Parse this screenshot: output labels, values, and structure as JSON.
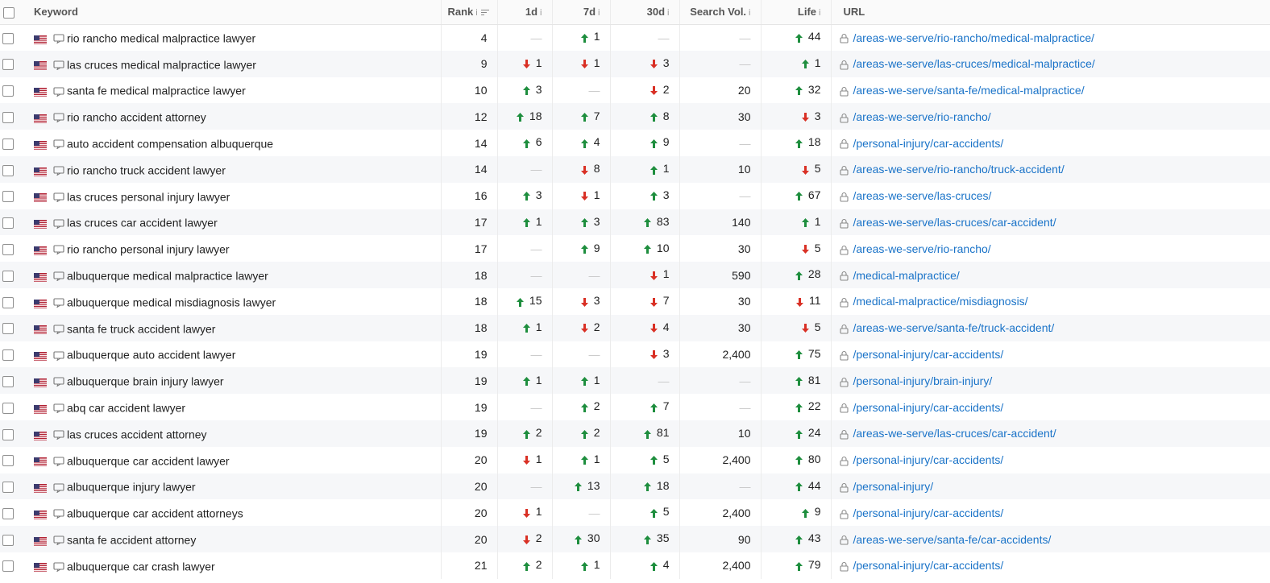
{
  "columns": {
    "keyword": "Keyword",
    "rank": "Rank",
    "d1": "1d",
    "d7": "7d",
    "d30": "30d",
    "search_vol": "Search Vol.",
    "life": "Life",
    "url": "URL"
  },
  "info_glyph": "i",
  "dash": "—",
  "colors": {
    "up": "#1e8e3e",
    "down": "#d93025",
    "link": "#1a73c8"
  },
  "icons": {
    "flag": "us-flag-icon",
    "serp": "serp-preview-icon",
    "lock": "lock-icon",
    "up": "arrow-up-icon",
    "down": "arrow-down-icon",
    "sort": "sort-icon"
  },
  "rows": [
    {
      "keyword": "rio rancho medical malpractice lawyer",
      "rank": "4",
      "d1": null,
      "d7": {
        "dir": "up",
        "value": "1"
      },
      "d30": null,
      "search_vol": null,
      "life": {
        "dir": "up",
        "value": "44"
      },
      "url": "/areas-we-serve/rio-rancho/medical-malpractice/"
    },
    {
      "keyword": "las cruces medical malpractice lawyer",
      "rank": "9",
      "d1": {
        "dir": "down",
        "value": "1"
      },
      "d7": {
        "dir": "down",
        "value": "1"
      },
      "d30": {
        "dir": "down",
        "value": "3"
      },
      "search_vol": null,
      "life": {
        "dir": "up",
        "value": "1"
      },
      "url": "/areas-we-serve/las-cruces/medical-malpractice/"
    },
    {
      "keyword": "santa fe medical malpractice lawyer",
      "rank": "10",
      "d1": {
        "dir": "up",
        "value": "3"
      },
      "d7": null,
      "d30": {
        "dir": "down",
        "value": "2"
      },
      "search_vol": "20",
      "life": {
        "dir": "up",
        "value": "32"
      },
      "url": "/areas-we-serve/santa-fe/medical-malpractice/"
    },
    {
      "keyword": "rio rancho accident attorney",
      "rank": "12",
      "d1": {
        "dir": "up",
        "value": "18"
      },
      "d7": {
        "dir": "up",
        "value": "7"
      },
      "d30": {
        "dir": "up",
        "value": "8"
      },
      "search_vol": "30",
      "life": {
        "dir": "down",
        "value": "3"
      },
      "url": "/areas-we-serve/rio-rancho/"
    },
    {
      "keyword": "auto accident compensation albuquerque",
      "rank": "14",
      "d1": {
        "dir": "up",
        "value": "6"
      },
      "d7": {
        "dir": "up",
        "value": "4"
      },
      "d30": {
        "dir": "up",
        "value": "9"
      },
      "search_vol": null,
      "life": {
        "dir": "up",
        "value": "18"
      },
      "url": "/personal-injury/car-accidents/"
    },
    {
      "keyword": "rio rancho truck accident lawyer",
      "rank": "14",
      "d1": null,
      "d7": {
        "dir": "down",
        "value": "8"
      },
      "d30": {
        "dir": "up",
        "value": "1"
      },
      "search_vol": "10",
      "life": {
        "dir": "down",
        "value": "5"
      },
      "url": "/areas-we-serve/rio-rancho/truck-accident/"
    },
    {
      "keyword": "las cruces personal injury lawyer",
      "rank": "16",
      "d1": {
        "dir": "up",
        "value": "3"
      },
      "d7": {
        "dir": "down",
        "value": "1"
      },
      "d30": {
        "dir": "up",
        "value": "3"
      },
      "search_vol": null,
      "life": {
        "dir": "up",
        "value": "67"
      },
      "url": "/areas-we-serve/las-cruces/"
    },
    {
      "keyword": "las cruces car accident lawyer",
      "rank": "17",
      "d1": {
        "dir": "up",
        "value": "1"
      },
      "d7": {
        "dir": "up",
        "value": "3"
      },
      "d30": {
        "dir": "up",
        "value": "83"
      },
      "search_vol": "140",
      "life": {
        "dir": "up",
        "value": "1"
      },
      "url": "/areas-we-serve/las-cruces/car-accident/"
    },
    {
      "keyword": "rio rancho personal injury lawyer",
      "rank": "17",
      "d1": null,
      "d7": {
        "dir": "up",
        "value": "9"
      },
      "d30": {
        "dir": "up",
        "value": "10"
      },
      "search_vol": "30",
      "life": {
        "dir": "down",
        "value": "5"
      },
      "url": "/areas-we-serve/rio-rancho/"
    },
    {
      "keyword": "albuquerque medical malpractice lawyer",
      "rank": "18",
      "d1": null,
      "d7": null,
      "d30": {
        "dir": "down",
        "value": "1"
      },
      "search_vol": "590",
      "life": {
        "dir": "up",
        "value": "28"
      },
      "url": "/medical-malpractice/"
    },
    {
      "keyword": "albuquerque medical misdiagnosis lawyer",
      "rank": "18",
      "d1": {
        "dir": "up",
        "value": "15"
      },
      "d7": {
        "dir": "down",
        "value": "3"
      },
      "d30": {
        "dir": "down",
        "value": "7"
      },
      "search_vol": "30",
      "life": {
        "dir": "down",
        "value": "11"
      },
      "url": "/medical-malpractice/misdiagnosis/"
    },
    {
      "keyword": "santa fe truck accident lawyer",
      "rank": "18",
      "d1": {
        "dir": "up",
        "value": "1"
      },
      "d7": {
        "dir": "down",
        "value": "2"
      },
      "d30": {
        "dir": "down",
        "value": "4"
      },
      "search_vol": "30",
      "life": {
        "dir": "down",
        "value": "5"
      },
      "url": "/areas-we-serve/santa-fe/truck-accident/"
    },
    {
      "keyword": "albuquerque auto accident lawyer",
      "rank": "19",
      "d1": null,
      "d7": null,
      "d30": {
        "dir": "down",
        "value": "3"
      },
      "search_vol": "2,400",
      "life": {
        "dir": "up",
        "value": "75"
      },
      "url": "/personal-injury/car-accidents/"
    },
    {
      "keyword": "albuquerque brain injury lawyer",
      "rank": "19",
      "d1": {
        "dir": "up",
        "value": "1"
      },
      "d7": {
        "dir": "up",
        "value": "1"
      },
      "d30": null,
      "search_vol": null,
      "life": {
        "dir": "up",
        "value": "81"
      },
      "url": "/personal-injury/brain-injury/"
    },
    {
      "keyword": "abq car accident lawyer",
      "rank": "19",
      "d1": null,
      "d7": {
        "dir": "up",
        "value": "2"
      },
      "d30": {
        "dir": "up",
        "value": "7"
      },
      "search_vol": null,
      "life": {
        "dir": "up",
        "value": "22"
      },
      "url": "/personal-injury/car-accidents/"
    },
    {
      "keyword": "las cruces accident attorney",
      "rank": "19",
      "d1": {
        "dir": "up",
        "value": "2"
      },
      "d7": {
        "dir": "up",
        "value": "2"
      },
      "d30": {
        "dir": "up",
        "value": "81"
      },
      "search_vol": "10",
      "life": {
        "dir": "up",
        "value": "24"
      },
      "url": "/areas-we-serve/las-cruces/car-accident/"
    },
    {
      "keyword": "albuquerque car accident lawyer",
      "rank": "20",
      "d1": {
        "dir": "down",
        "value": "1"
      },
      "d7": {
        "dir": "up",
        "value": "1"
      },
      "d30": {
        "dir": "up",
        "value": "5"
      },
      "search_vol": "2,400",
      "life": {
        "dir": "up",
        "value": "80"
      },
      "url": "/personal-injury/car-accidents/"
    },
    {
      "keyword": "albuquerque injury lawyer",
      "rank": "20",
      "d1": null,
      "d7": {
        "dir": "up",
        "value": "13"
      },
      "d30": {
        "dir": "up",
        "value": "18"
      },
      "search_vol": null,
      "life": {
        "dir": "up",
        "value": "44"
      },
      "url": "/personal-injury/"
    },
    {
      "keyword": "albuquerque car accident attorneys",
      "rank": "20",
      "d1": {
        "dir": "down",
        "value": "1"
      },
      "d7": null,
      "d30": {
        "dir": "up",
        "value": "5"
      },
      "search_vol": "2,400",
      "life": {
        "dir": "up",
        "value": "9"
      },
      "url": "/personal-injury/car-accidents/"
    },
    {
      "keyword": "santa fe accident attorney",
      "rank": "20",
      "d1": {
        "dir": "down",
        "value": "2"
      },
      "d7": {
        "dir": "up",
        "value": "30"
      },
      "d30": {
        "dir": "up",
        "value": "35"
      },
      "search_vol": "90",
      "life": {
        "dir": "up",
        "value": "43"
      },
      "url": "/areas-we-serve/santa-fe/car-accidents/"
    },
    {
      "keyword": "albuquerque car crash lawyer",
      "rank": "21",
      "d1": {
        "dir": "up",
        "value": "2"
      },
      "d7": {
        "dir": "up",
        "value": "1"
      },
      "d30": {
        "dir": "up",
        "value": "4"
      },
      "search_vol": "2,400",
      "life": {
        "dir": "up",
        "value": "79"
      },
      "url": "/personal-injury/car-accidents/"
    }
  ]
}
